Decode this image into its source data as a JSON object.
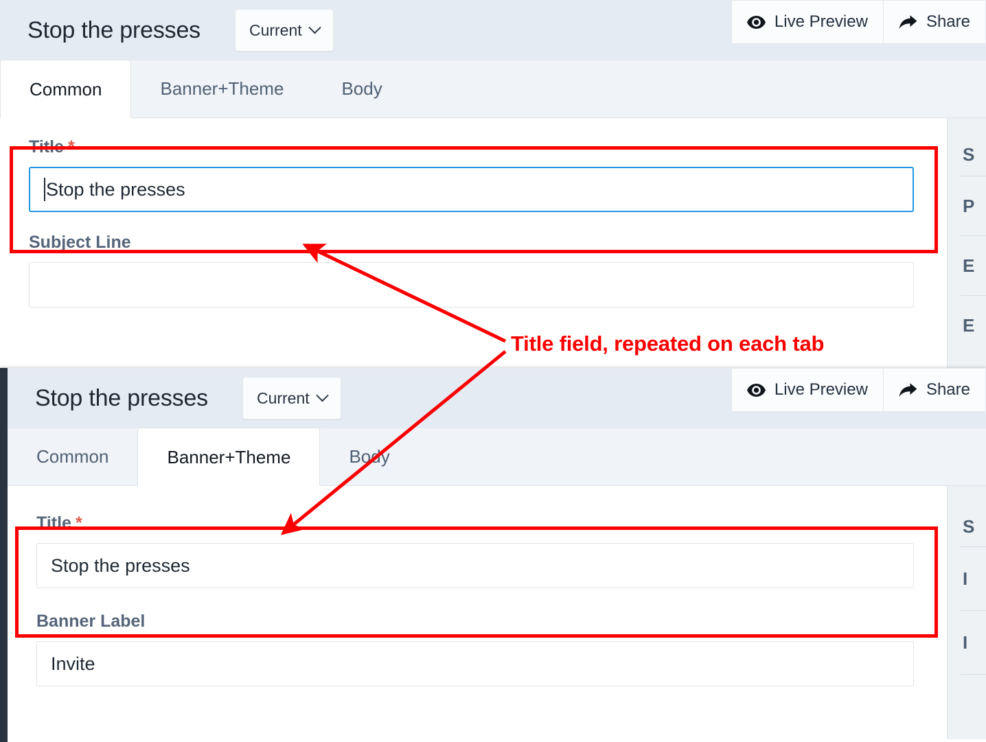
{
  "panel_top": {
    "header": {
      "app_title": "Stop the presses",
      "version_label": "Current",
      "version_chevron_icon": "chevron-down-icon",
      "live_preview_label": "Live Preview",
      "live_preview_icon": "eye-icon",
      "share_label": "Share",
      "share_icon": "share-arrow-icon"
    },
    "tabs": [
      {
        "label": "Common",
        "active": true
      },
      {
        "label": "Banner+Theme",
        "active": false
      },
      {
        "label": "Body",
        "active": false
      }
    ],
    "fields": [
      {
        "label": "Title",
        "required_marker": "*",
        "value": "Stop the presses",
        "placeholder": "",
        "focused": true
      },
      {
        "label": "Subject Line",
        "required_marker": "",
        "value": "",
        "placeholder": "",
        "focused": false
      }
    ],
    "side_rail_items": [
      "S",
      "P",
      "E",
      "E"
    ]
  },
  "panel_bottom": {
    "header": {
      "app_title": "Stop the presses",
      "version_label": "Current",
      "version_chevron_icon": "chevron-down-icon",
      "live_preview_label": "Live Preview",
      "live_preview_icon": "eye-icon",
      "share_label": "Share",
      "share_icon": "share-arrow-icon"
    },
    "tabs": [
      {
        "label": "Common",
        "active": false
      },
      {
        "label": "Banner+Theme",
        "active": true
      },
      {
        "label": "Body",
        "active": false
      }
    ],
    "fields": [
      {
        "label": "Title",
        "required_marker": "*",
        "value": "Stop the presses",
        "placeholder": "",
        "focused": false
      },
      {
        "label": "Banner Label",
        "required_marker": "",
        "value": "Invite",
        "placeholder": "",
        "focused": false
      }
    ],
    "side_rail_items": [
      "S",
      "I",
      "I"
    ]
  },
  "annotation": {
    "callout_text": "Title field, repeated on each tab",
    "color": "#fb0000"
  },
  "colors": {
    "header_bg": "#e5ebf2",
    "tabbar_bg": "#f0f3f7",
    "rail_bg": "#eef2f5",
    "focus_blue": "#2196e3",
    "required_red": "#e05c4b",
    "annotation_red": "#fb0000",
    "label_gray": "#56657a"
  }
}
